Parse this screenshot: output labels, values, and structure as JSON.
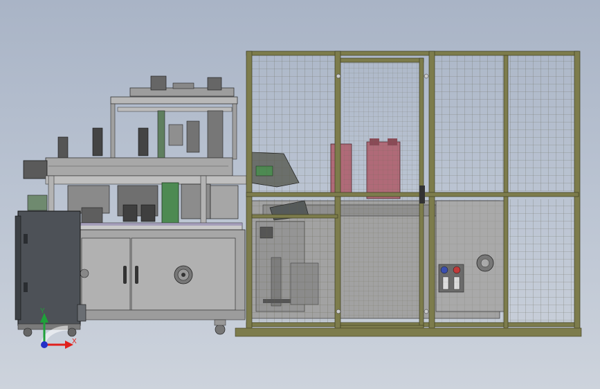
{
  "triad": {
    "x_label": "X",
    "y_label": "Y",
    "x_color": "#e0201c",
    "y_color": "#1fa13a",
    "z_color": "#2430c8"
  },
  "colors": {
    "frame": "#7d7c4c",
    "frame_dark": "#585733",
    "mesh": "#5f5f4a",
    "machine_grey": "#9a9a9a",
    "cabinet_dark": "#4d5157",
    "pink_part": "#b06a78",
    "green_part": "#4d8a52"
  }
}
